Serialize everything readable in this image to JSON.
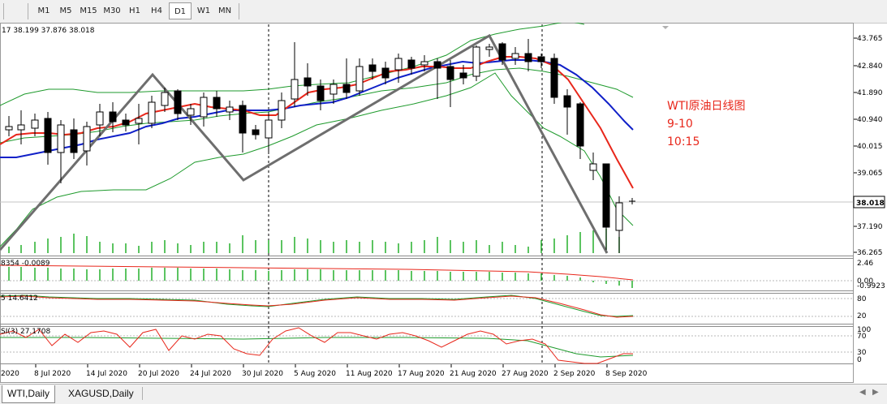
{
  "toolbar": {
    "timeframes": [
      "M1",
      "M5",
      "M15",
      "M30",
      "H1",
      "H4",
      "D1",
      "W1",
      "MN"
    ],
    "active": "D1"
  },
  "main_panel": {
    "ohlc_header": "17 38.199 37.876 38.018",
    "price_labels": [
      "43.765",
      "42.840",
      "41.890",
      "40.940",
      "40.015",
      "39.065",
      "38.018",
      "37.190",
      "36.265"
    ],
    "current_price": "38.018",
    "annotation": {
      "line1": "WTI原油日线图",
      "line2": "9-10",
      "line3": "10:15",
      "color": "#e8271b"
    }
  },
  "macd_panel": {
    "header": "8354 -0.0089",
    "scale_labels": [
      "2.46",
      "0.00",
      "-0.9923"
    ]
  },
  "stoch_panel": {
    "header": "5 14.6412",
    "scale_labels": [
      "80",
      "20"
    ]
  },
  "rsi_panel": {
    "header": "SI(3) 27.1708",
    "scale_labels": [
      "100",
      "70",
      "30",
      "0"
    ]
  },
  "date_axis": [
    "2020",
    "8 Jul 2020",
    "14 Jul 2020",
    "20 Jul 2020",
    "24 Jul 2020",
    "30 Jul 2020",
    "5 Aug 2020",
    "11 Aug 2020",
    "17 Aug 2020",
    "21 Aug 2020",
    "27 Aug 2020",
    "2 Sep 2020",
    "8 Sep 2020"
  ],
  "tabs": [
    "WTI,Daily",
    "XAGUSD,Daily"
  ],
  "active_tab": "WTI,Daily",
  "colors": {
    "candle_up_fill": "#ffffff",
    "candle_down_fill": "#000000",
    "ma_fast": "#e8271b",
    "ma_slow": "#1020c8",
    "bollinger": "#1e9a2c",
    "zigzag": "#6e6e6e",
    "volume": "#25b02c"
  }
}
